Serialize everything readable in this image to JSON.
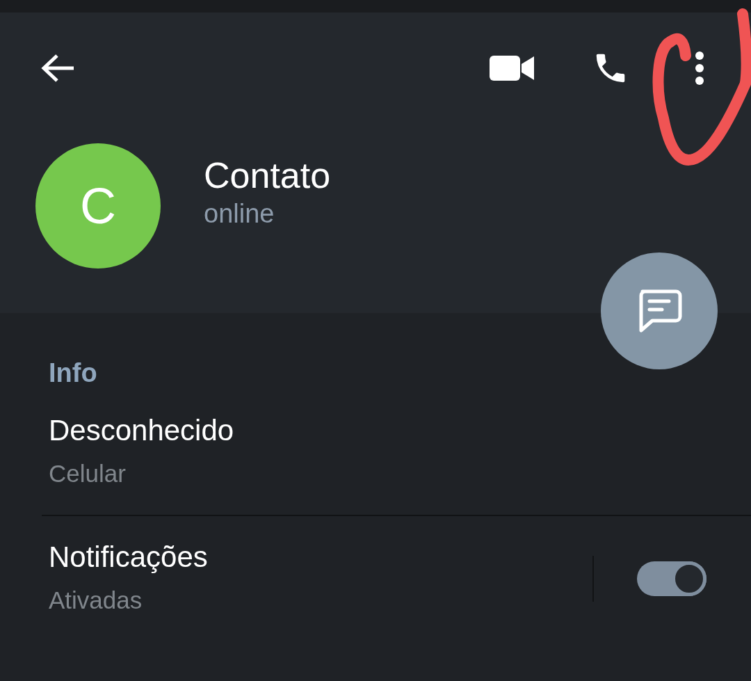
{
  "profile": {
    "initial": "C",
    "name": "Contato",
    "status": "online"
  },
  "section_title": "Info",
  "rows": [
    {
      "kind": "plain",
      "title": "Desconhecido",
      "subtitle": "Celular"
    },
    {
      "kind": "toggle",
      "title": "Notificações",
      "subtitle": "Ativadas",
      "on": true
    }
  ]
}
